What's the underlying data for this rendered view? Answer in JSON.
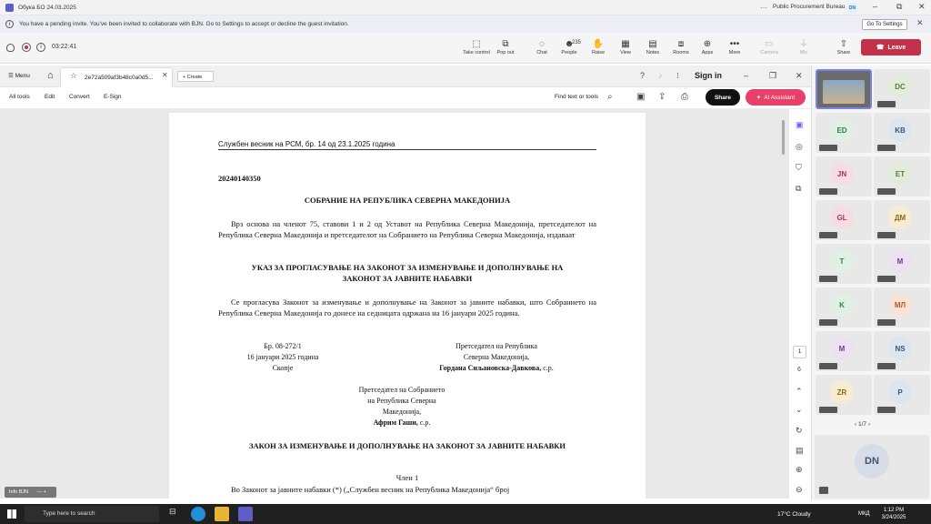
{
  "window": {
    "title": "Обука БО 24.03.2025",
    "org": "Public Procurement Bureau",
    "avatar": "DN"
  },
  "banner": {
    "text": "You have a pending invite. You've been invited to collaborate with BJN. Go to Settings to accept or decline the guest invitation.",
    "button": "Go To Settings"
  },
  "meeting": {
    "timer": "03:22:41",
    "tools": [
      {
        "label": "Take control",
        "icon": "⬚"
      },
      {
        "label": "Pop out",
        "icon": "⧉"
      },
      {
        "label": "Chat",
        "icon": "◌"
      },
      {
        "label": "People",
        "icon": "☻",
        "count": "235"
      },
      {
        "label": "Raise",
        "icon": "✋"
      },
      {
        "label": "View",
        "icon": "▦"
      },
      {
        "label": "Notes",
        "icon": "▤"
      },
      {
        "label": "Rooms",
        "icon": "⧈"
      },
      {
        "label": "Apps",
        "icon": "⊕"
      },
      {
        "label": "More",
        "icon": "•••"
      },
      {
        "label": "Camera",
        "icon": "▭"
      },
      {
        "label": "Mic",
        "icon": "⏚"
      },
      {
        "label": "Share",
        "icon": "⇧"
      }
    ],
    "leave": "Leave"
  },
  "acrobat": {
    "menu": "Menu",
    "tab": "2e72a509af3b48c0a0d5...",
    "create": "Create",
    "signin": "Sign in",
    "tools": [
      "All tools",
      "Edit",
      "Convert",
      "E-Sign"
    ],
    "find": "Find text or tools",
    "share": "Share",
    "ai": "AI Assistant",
    "page_current": "1",
    "page_total": "6"
  },
  "doc": {
    "header": "Службен весник на РСМ, бр. 14 од 23.1.2025 година",
    "number": "20240140350",
    "assembly": "СОБРАНИЕ НА РЕПУБЛИКА СЕВЕРНА МАКЕДОНИЈА",
    "para1": "Врз основа на членот 75, ставови 1 и 2 од Уставот на Република Северна Македонија, претседателот на Република Северна Македонија и претседателот на Собранието на Република Северна Македонија, издаваат",
    "decree": "УКАЗ ЗА ПРОГЛАСУВАЊЕ НА ЗАКОНОТ ЗА ИЗМЕНУВАЊЕ И ДОПОЛНУВАЊЕ НА ЗАКОНОТ ЗА ЈАВНИТЕ НАБАВКИ",
    "para2": "Се прогласува Законот за изменување и дополнување на Законот за јавните набавки, што Собранието на Република Северна Македонија го донесе на седницата одржана на 16 јануари 2025 година.",
    "left": [
      "Бр. 08-272/1",
      "16 јануари 2025 година",
      "Скопје"
    ],
    "right": [
      "Претседател на Република",
      "Северна Македонија,",
      "Гордана Сиљановска-Давкова,",
      "с.р."
    ],
    "center": [
      "Претседател на Собранието",
      "на Република Северна",
      "Македонија,",
      "Африм Гаши,",
      "с.р."
    ],
    "law": "ЗАКОН ЗА ИЗМЕНУВАЊЕ И ДОПОЛНУВАЊЕ НА ЗАКОНОТ ЗА ЈАВНИТЕ НАБАВКИ",
    "article": "Член 1",
    "para3": "Во Законот за јавните набавки (*) („Службен весник на Република Македонија“ број"
  },
  "participants": [
    "DC",
    "ED",
    "KB",
    "JN",
    "ET",
    "GL",
    "ДМ",
    "T",
    "M",
    "K",
    "МЛ",
    "M",
    "NS",
    "ZR",
    "P"
  ],
  "pager": "1/7",
  "self": "DN",
  "infobjn": "Info BJN",
  "taskbar": {
    "search": "Type here to search",
    "weather": "17°C Cloudy",
    "lang": "МКД",
    "time": "1:12 PM",
    "date": "3/24/2025"
  }
}
